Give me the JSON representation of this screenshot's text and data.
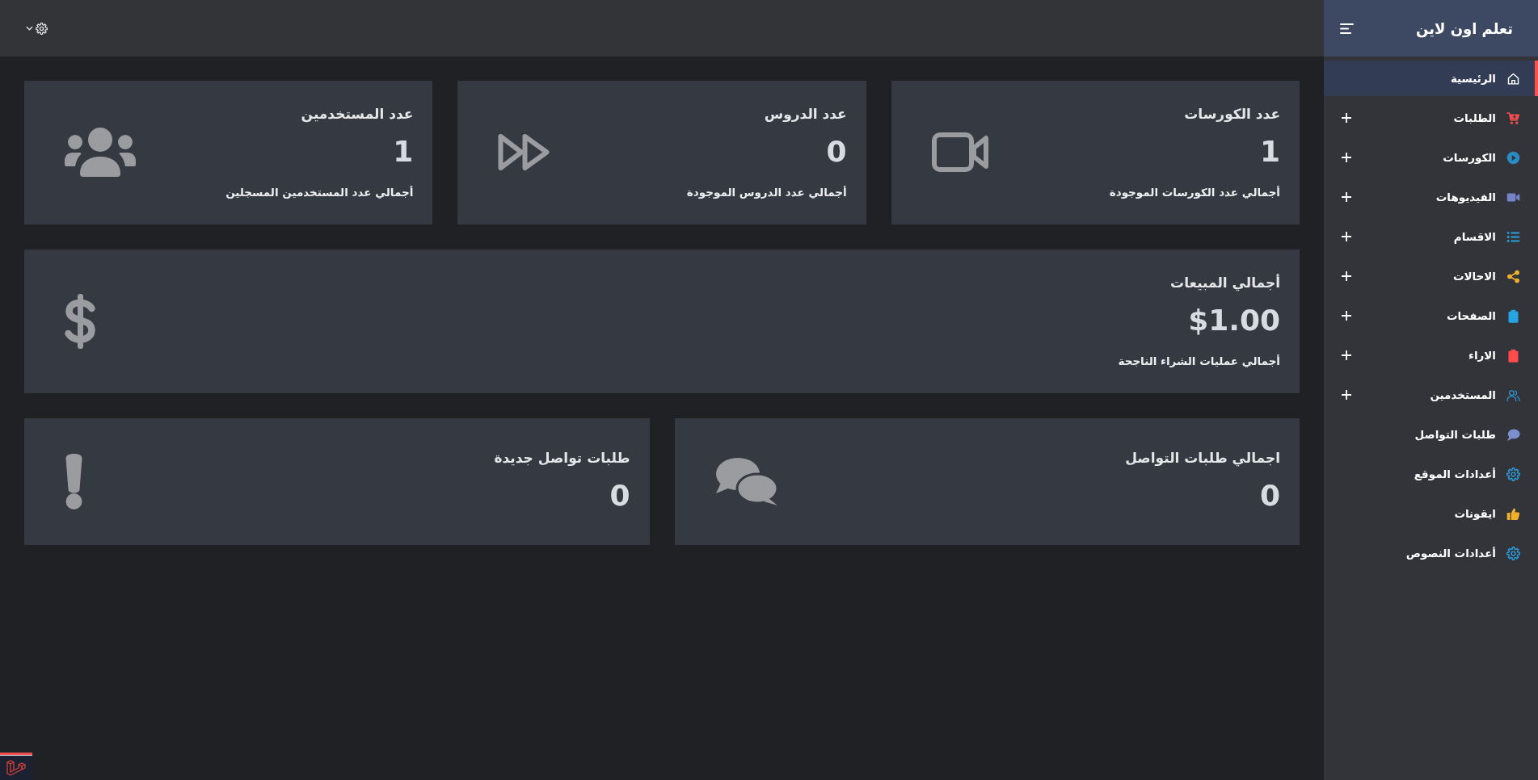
{
  "sidebar": {
    "title": "تعلم اون لاين",
    "items": [
      {
        "label": "الرئيسية",
        "selected": true,
        "has_submenu": false,
        "color": "#ffffff"
      },
      {
        "label": "الطلبات",
        "selected": false,
        "has_submenu": true,
        "color": "#f44e4e"
      },
      {
        "label": "الكورسات",
        "selected": false,
        "has_submenu": true,
        "color": "#2a8bc5"
      },
      {
        "label": "الفيديوهات",
        "selected": false,
        "has_submenu": true,
        "color": "#7584c9"
      },
      {
        "label": "الاقسام",
        "selected": false,
        "has_submenu": true,
        "color": "#2b9fe0"
      },
      {
        "label": "الاحالات",
        "selected": false,
        "has_submenu": true,
        "color": "#f0b02e"
      },
      {
        "label": "الصفحات",
        "selected": false,
        "has_submenu": true,
        "color": "#27a3e3"
      },
      {
        "label": "الاراء",
        "selected": false,
        "has_submenu": true,
        "color": "#ff4d4d"
      },
      {
        "label": "المستخدمين",
        "selected": false,
        "has_submenu": true,
        "color": "#2f93d0"
      },
      {
        "label": "طلبات التواصل",
        "selected": false,
        "has_submenu": false,
        "color": "#7b8ed0"
      },
      {
        "label": "أعدادات الموقع",
        "selected": false,
        "has_submenu": false,
        "color": "#2a9fdf"
      },
      {
        "label": "ايقونات",
        "selected": false,
        "has_submenu": false,
        "color": "#f0b02e"
      },
      {
        "label": "أعدادات النصوص",
        "selected": false,
        "has_submenu": false,
        "color": "#2a9fdf"
      }
    ]
  },
  "card_rows": [
    [
      {
        "title": "عدد الكورسات",
        "value": "1",
        "caption": "أجمالي عدد الكورسات الموجودة"
      },
      {
        "title": "عدد الدروس",
        "value": "0",
        "caption": "أجمالي عدد الدروس الموجودة"
      },
      {
        "title": "عدد المستخدمين",
        "value": "1",
        "caption": "أجمالي عدد المستخدمين المسجلين"
      }
    ],
    [
      {
        "title": "أجمالي المبيعات",
        "value": "$1.00",
        "caption": "أجمالي عمليات الشراء الناجحة"
      }
    ],
    [
      {
        "title": "اجمالي طلبات التواصل",
        "value": "0"
      },
      {
        "title": "طلبات تواصل جديدة",
        "value": "0"
      }
    ]
  ]
}
